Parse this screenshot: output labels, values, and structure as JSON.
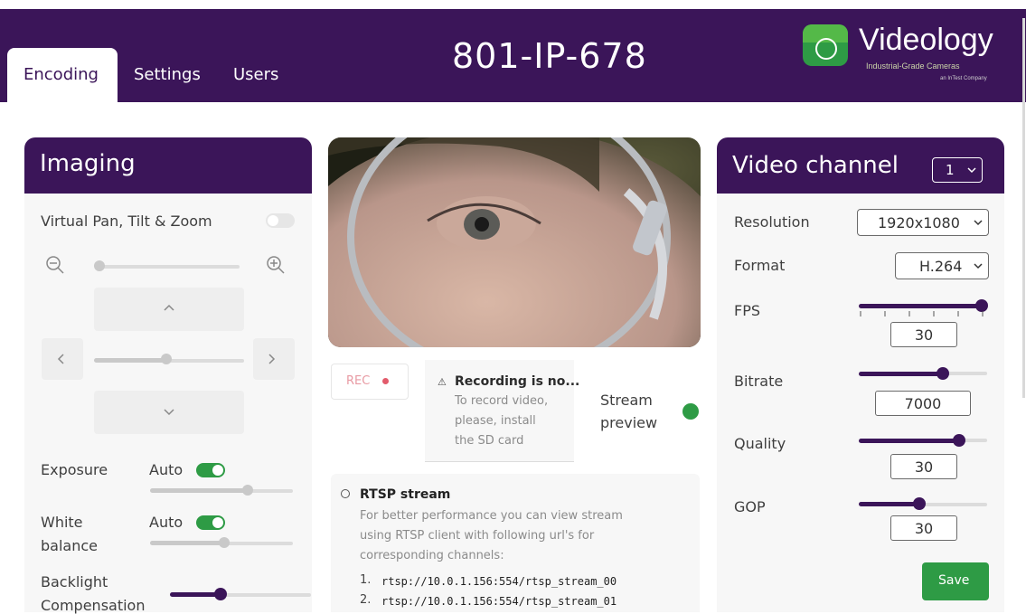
{
  "header": {
    "camera_name": "801-IP-678",
    "tabs": [
      {
        "label": "Encoding",
        "active": true
      },
      {
        "label": "Settings",
        "active": false
      },
      {
        "label": "Users",
        "active": false
      }
    ],
    "logo": {
      "name": "Videology",
      "tagline": "Industrial-Grade Cameras",
      "subtag": "an InTest Company",
      "brand_color": "#54b948"
    }
  },
  "imaging": {
    "title": "Imaging",
    "vptz_label": "Virtual Pan, Tilt & Zoom",
    "vptz_enabled": false,
    "zoom_level": 0,
    "pan_level": 0.5,
    "exposure_label": "Exposure",
    "exposure_mode": "Auto",
    "exposure_level": 0.7,
    "white_balance_label_1": "White",
    "white_balance_label_2": "balance",
    "white_balance_mode": "Auto",
    "white_balance_level": 0.55,
    "backlight_label_1": "Backlight",
    "backlight_label_2": "Compensation",
    "backlight_level": 0.35
  },
  "center": {
    "rec_label": "REC",
    "recording_title": "Recording is no...",
    "recording_text_1": "To record video,",
    "recording_text_2": "please, install",
    "recording_text_3": "the SD card",
    "stream_preview_1": "Stream",
    "stream_preview_2": "preview",
    "stream_preview_on": true,
    "rtsp_title": "RTSP stream",
    "rtsp_text_1": "For better performance you can view stream",
    "rtsp_text_2": "using RTSP client with following url's for",
    "rtsp_text_3": "corresponding channels:",
    "rtsp_urls": [
      "rtsp://10.0.1.156:554/rtsp_stream_00",
      "rtsp://10.0.1.156:554/rtsp_stream_01"
    ]
  },
  "video_channel": {
    "title": "Video channel",
    "channel": "1",
    "resolution_label": "Resolution",
    "resolution": "1920x1080",
    "format_label": "Format",
    "format": "H.264",
    "fps_label": "FPS",
    "fps": "30",
    "fps_level": 1.0,
    "bitrate_label": "Bitrate",
    "bitrate": "7000",
    "bitrate_level": 0.62,
    "quality_label": "Quality",
    "quality": "30",
    "quality_level": 0.78,
    "gop_label": "GOP",
    "gop": "30",
    "gop_level": 0.45,
    "save_label": "Save"
  },
  "colors": {
    "primary": "#3b1559",
    "accent_green": "#2e9b45",
    "rec_red": "#e25b6b"
  }
}
